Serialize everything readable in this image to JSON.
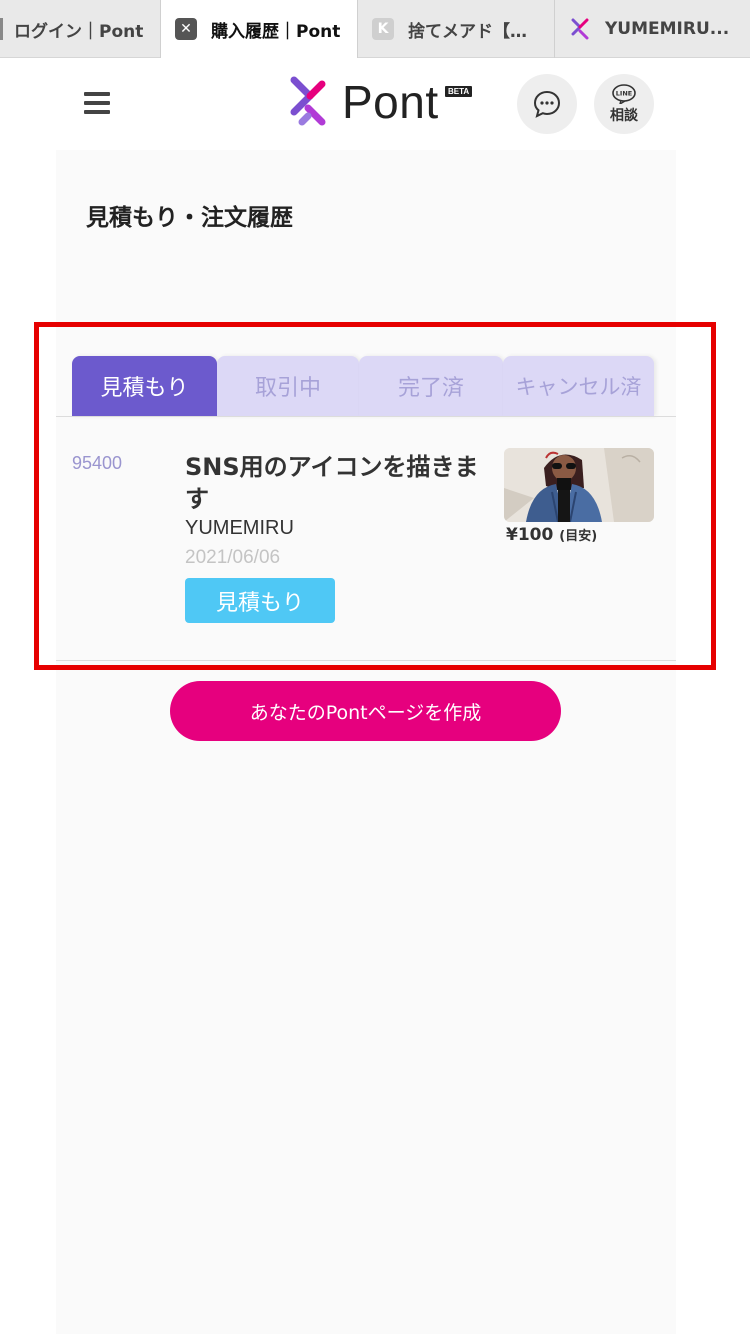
{
  "browser": {
    "tabs": [
      {
        "title": "ログイン｜Pont",
        "active": false
      },
      {
        "title": "購入履歴｜Pont",
        "active": true
      },
      {
        "title": "捨てメアド【…",
        "active": false
      },
      {
        "title": "YUMEMIRU...",
        "active": false
      }
    ]
  },
  "header": {
    "logo_text": "Pont",
    "beta_badge": "BETA",
    "menu_icon": "hamburger-menu-icon",
    "message_icon": "chat-bubble-icon",
    "line_icon_text": "LINE",
    "line_label": "相談"
  },
  "page": {
    "title": "見積もり・注文履歴"
  },
  "status_tabs": [
    {
      "label": "見積もり",
      "active": true
    },
    {
      "label": "取引中",
      "active": false
    },
    {
      "label": "完了済",
      "active": false
    },
    {
      "label": "キャンセル済",
      "active": false
    }
  ],
  "orders": [
    {
      "id": "95400",
      "title": "SNS用のアイコンを描きます",
      "seller": "YUMEMIRU",
      "date": "2021/06/06",
      "status": "見積もり",
      "price": "¥100",
      "price_note": "(目安)"
    }
  ],
  "cta": {
    "label": "あなたのPontページを作成"
  },
  "colors": {
    "accent_purple": "#6c5acd",
    "tab_inactive": "#dcd8f6",
    "status_blue": "#4fc8f5",
    "cta_pink": "#e6007e",
    "highlight_red": "#e60000"
  }
}
